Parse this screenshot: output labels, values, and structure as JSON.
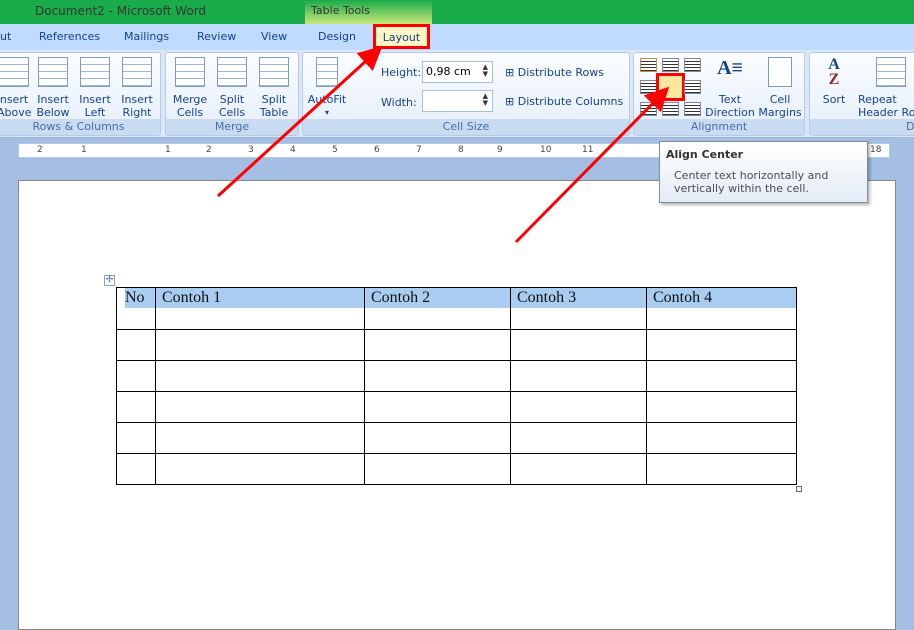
{
  "title": "Document2 - Microsoft Word",
  "context_tab": "Table Tools",
  "tabs": [
    "ut",
    "References",
    "Mailings",
    "Review",
    "View",
    "Design",
    "Layout"
  ],
  "groups": {
    "rows_columns": {
      "label": "Rows & Columns",
      "buttons": [
        "nsert\nAbove",
        "Insert\nBelow",
        "Insert\nLeft",
        "Insert\nRight"
      ]
    },
    "merge": {
      "label": "Merge",
      "buttons": [
        "Merge\nCells",
        "Split\nCells",
        "Split\nTable"
      ]
    },
    "cell_size": {
      "label": "Cell Size",
      "autofit": "AutoFit",
      "height_label": "Height:",
      "height_value": "0,98 cm",
      "width_label": "Width:",
      "width_value": "",
      "distribute_rows": "Distribute Rows",
      "distribute_columns": "Distribute Columns"
    },
    "alignment": {
      "label": "Alignment",
      "text_direction": "Text\nDirection",
      "cell_margins": "Cell\nMargins"
    },
    "data": {
      "label": "D",
      "sort": "Sort",
      "repeat": "Repeat\nHeader Rov"
    }
  },
  "ruler": [
    "2",
    "1",
    "1",
    "2",
    "3",
    "4",
    "5",
    "6",
    "7",
    "8",
    "9",
    "10",
    "11",
    "12",
    "18"
  ],
  "tooltip": {
    "title": "Align Center",
    "body": "Center text horizontally and vertically within the cell."
  },
  "table": {
    "headers": [
      "No",
      "Contoh 1",
      "Contoh 2",
      "Contoh 3",
      "Contoh 4"
    ],
    "empty_rows": 5
  },
  "colors": {
    "titlebar": "#1aab4a",
    "highlight": "#f00",
    "selection": "#a9cdf1"
  }
}
